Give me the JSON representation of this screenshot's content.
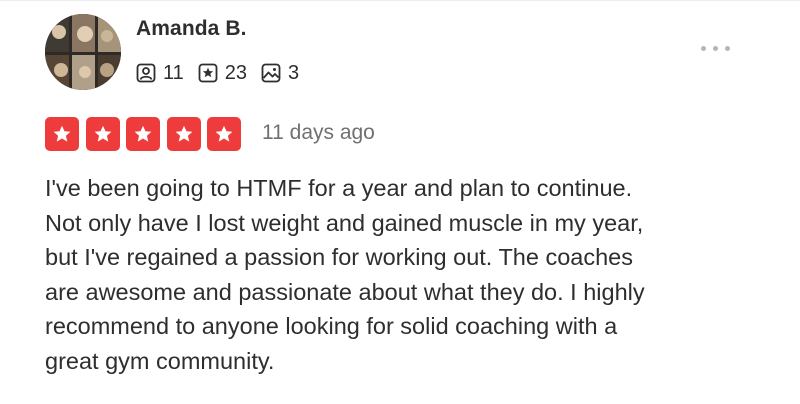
{
  "review": {
    "user": {
      "name": "Amanda B.",
      "avatar_icon": "user-photo-avatar",
      "stats": [
        {
          "icon": "friends-icon",
          "value": "11"
        },
        {
          "icon": "star-badge-icon",
          "value": "23"
        },
        {
          "icon": "photo-icon",
          "value": "3"
        }
      ]
    },
    "more_icon": "more-options-icon",
    "rating": {
      "value": 5,
      "max": 5,
      "color": "#ee3b3b"
    },
    "date": "11 days ago",
    "text": "I've been going to HTMF for a year and plan to continue.\nNot only have I lost weight and gained muscle in my year,\nbut I've regained a passion for working out. The coaches\nare awesome and passionate about what they do. I highly\nrecommend to anyone looking for solid coaching with a\ngreat gym community."
  },
  "colors": {
    "text": "#2d2e2f",
    "muted": "#6e7072",
    "icon_stroke": "#2d2e2f",
    "dots": "#b5b5b5"
  }
}
